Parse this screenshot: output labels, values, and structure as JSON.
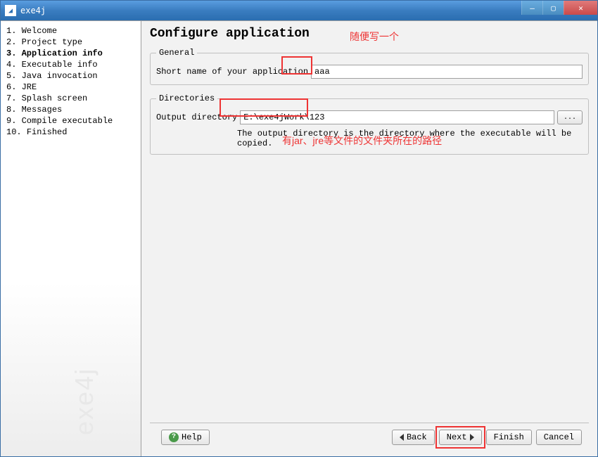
{
  "window": {
    "title": "exe4j"
  },
  "sidebar": {
    "items": [
      {
        "num": "1.",
        "label": "Welcome"
      },
      {
        "num": "2.",
        "label": "Project type"
      },
      {
        "num": "3.",
        "label": "Application info"
      },
      {
        "num": "4.",
        "label": "Executable info"
      },
      {
        "num": "5.",
        "label": "Java invocation"
      },
      {
        "num": "6.",
        "label": "JRE"
      },
      {
        "num": "7.",
        "label": "Splash screen"
      },
      {
        "num": "8.",
        "label": "Messages"
      },
      {
        "num": "9.",
        "label": "Compile executable"
      },
      {
        "num": "10.",
        "label": "Finished"
      }
    ],
    "active_index": 2,
    "watermark": "exe4j"
  },
  "main": {
    "title": "Configure application",
    "general": {
      "legend": "General",
      "shortname_label": "Short name of your application",
      "shortname_value": "aaa"
    },
    "directories": {
      "legend": "Directories",
      "output_label": "Output directory",
      "output_value": "E:\\exe4jWork\\123",
      "browse_label": "...",
      "hint": "The output directory is the directory where the executable will be copied."
    }
  },
  "annotations": {
    "top": "随便写一个",
    "bottom": "有jar、jre等文件的文件夹所在的路径"
  },
  "footer": {
    "help": "Help",
    "back": "Back",
    "next": "Next",
    "finish": "Finish",
    "cancel": "Cancel"
  }
}
